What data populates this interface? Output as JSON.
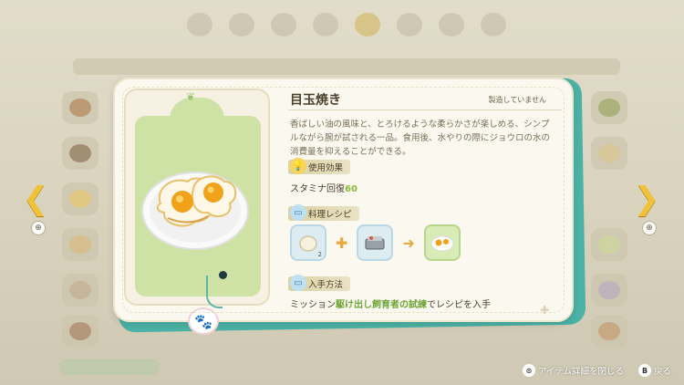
{
  "item": {
    "title": "目玉焼き",
    "status": "製造していません",
    "description": "香ばしい油の風味と、とろけるような柔らかさが楽しめる、シンプルながら腕が試される一品。食用後、水やりの際にジョウロの水の消費量を抑えることができる。"
  },
  "effect": {
    "label": "使用効果",
    "icon": "lightbulb-icon",
    "stat_name": "スタミナ回復",
    "stat_value": "60"
  },
  "recipe": {
    "label": "料理レシピ",
    "icon": "recipe-card-icon",
    "ingredients": [
      {
        "name": "egg-icon",
        "count": "2"
      },
      {
        "name": "frying-pan-icon",
        "count": ""
      }
    ],
    "result": {
      "name": "fried-egg-icon"
    }
  },
  "obtain": {
    "label": "入手方法",
    "icon": "recipe-card-icon",
    "prefix": "ミッション",
    "mission": "駆け出し飼育者の試練",
    "suffix": "でレシピを入手"
  },
  "hints": {
    "close_label": "アイテム詳細を閉じる",
    "back_label": "戻る",
    "close_button": "⊙",
    "back_button": "B"
  },
  "colors": {
    "accent_green": "#8cb83a",
    "accent_yellow": "#f0c23a",
    "teal": "#4bb3a5"
  }
}
